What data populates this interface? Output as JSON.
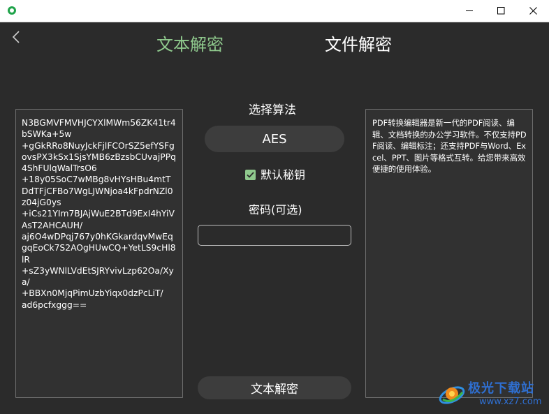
{
  "window": {
    "icon": "app-shield-icon",
    "controls": [
      "minimize-icon",
      "maximize-icon",
      "close-icon"
    ]
  },
  "nav": {
    "back_icon": "chevron-left-icon",
    "tabs": [
      {
        "label": "文本解密",
        "active": true,
        "color": "#8fc98d"
      },
      {
        "label": "文件解密",
        "active": false,
        "color": "#ffffff"
      }
    ]
  },
  "input_text": "N3BGMVFMVHJCYXlMWm56ZK41tr4bSWKa+5w\n+gGkRRo8NuyJckFjlFCOrSZ5efYSFgovsPX3kSx1SjsYMB6zBzsbCUvajPPq4ShFUlqWalTrsO6\n+18y05SoC7wMBg8vHYsHBu4mtTDdTFjCFBo7WgLJWNjoa4kFpdrNZl0z04jG0ys\n+iCs21YIm7BJAjWuE2BTd9ExI4hYiVAsT2AHCAUH/\naj6O4wDPqj767y0hKGkardqvMwEqgqEoCk7S2AOgHUwCQ+YetLS9cHl8lR\n+sZ3yWNlLVdEtSJRYvivLzp62Oa/Xya/\n+BBXn0MjqPimUzbYiqx0dzPcLiT/\nad6pcfxggg==",
  "algorithm": {
    "label": "选择算法",
    "selected": "AES"
  },
  "default_key": {
    "label": "默认秘钥",
    "checked": true
  },
  "password": {
    "label": "密码(可选)",
    "value": ""
  },
  "decrypt_button": "文本解密",
  "output_text": "PDF转换编辑器是新一代的PDF阅读、编辑、文档转换的办公学习软件。不仅支持PDF阅读、编辑标注；还支持PDF与Word、Excel、PPT、图片等格式互转。给您带来高效便捷的使用体验。",
  "watermark": {
    "name": "极光下载站",
    "url": "www.xz7.com"
  },
  "colors": {
    "background": "#2b2b2b",
    "accent": "#8fc98d",
    "panel": "#313131",
    "button": "#3d3d3d"
  }
}
